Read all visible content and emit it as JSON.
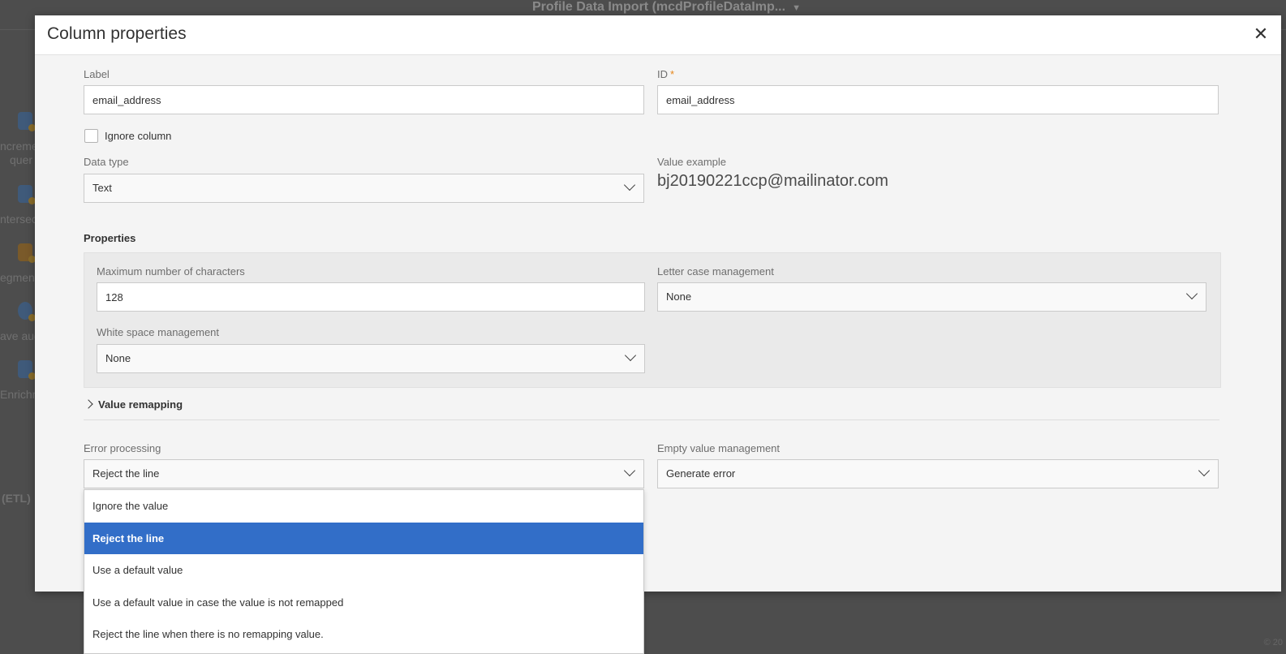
{
  "background": {
    "title": "Profile Data Import (mcdProfileDataImp...",
    "left_items": [
      "ncreme",
      "quer",
      "ntersec",
      "egmen",
      "ave aud",
      "Enrichm"
    ],
    "etl_label": "(ETL)",
    "bottom_right": "© 20"
  },
  "dialog": {
    "title": "Column properties",
    "close_icon": "✕",
    "label_field": {
      "label": "Label",
      "value": "email_address"
    },
    "id_field": {
      "label": "ID",
      "required_mark": "*",
      "value": "email_address"
    },
    "ignore_column": {
      "label": "Ignore column",
      "checked": false
    },
    "data_type": {
      "label": "Data type",
      "value": "Text"
    },
    "value_example": {
      "label": "Value example",
      "value": "bj20190221ccp@mailinator.com"
    },
    "properties": {
      "title": "Properties",
      "max_chars": {
        "label": "Maximum number of characters",
        "value": "128"
      },
      "letter_case": {
        "label": "Letter case management",
        "value": "None"
      },
      "white_space": {
        "label": "White space management",
        "value": "None"
      }
    },
    "value_remapping": {
      "label": "Value remapping"
    },
    "error_processing": {
      "label": "Error processing",
      "value": "Reject the line",
      "options": [
        "Ignore the value",
        "Reject the line",
        "Use a default value",
        "Use a default value in case the value is not remapped",
        "Reject the line when there is no remapping value."
      ],
      "selected_index": 1
    },
    "empty_value": {
      "label": "Empty value management",
      "value": "Generate error"
    }
  },
  "colors": {
    "accent": "#326ec8",
    "required": "#e68619",
    "overlay": "#4d4d4d"
  }
}
